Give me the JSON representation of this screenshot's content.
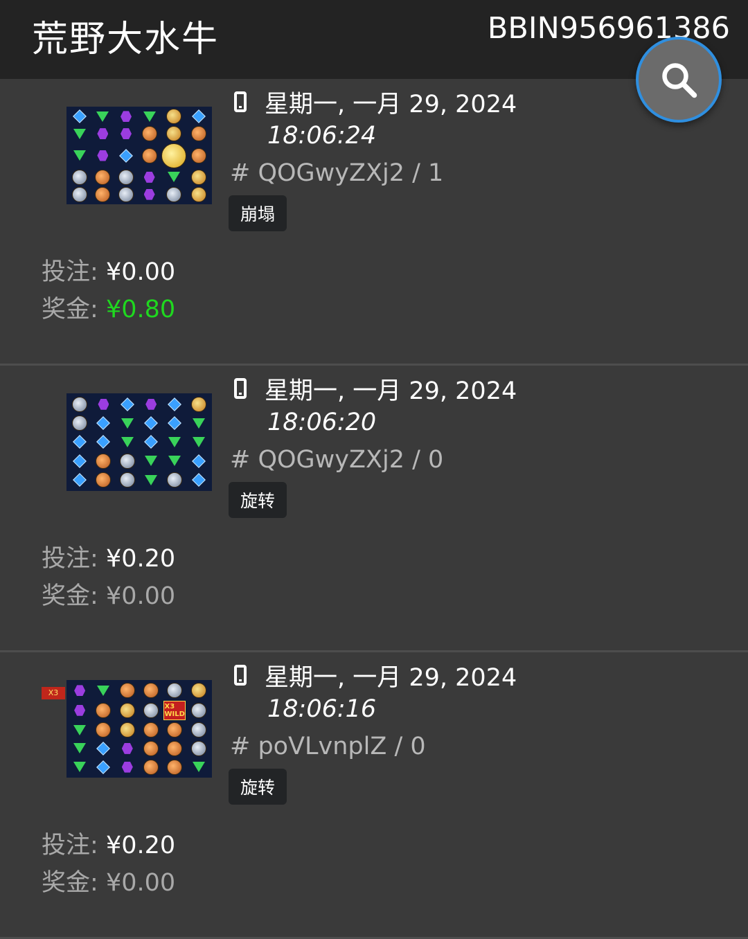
{
  "header": {
    "title": "荒野大水牛",
    "account_id": "BBIN956961386"
  },
  "search": {
    "icon": "search-icon"
  },
  "colors": {
    "win_positive": "#1fd81f",
    "header_bg": "#232323",
    "fab_border": "#2f8fe0"
  },
  "labels": {
    "bet": "投注:",
    "win": "奖金:"
  },
  "records": [
    {
      "date": "星期一, 一月 29, 2024",
      "time": "18:06:24",
      "round": "# QOGwyZXj2 / 1",
      "type": "崩塌",
      "bet": "¥0.00",
      "win": "¥0.80"
    },
    {
      "date": "星期一, 一月 29, 2024",
      "time": "18:06:20",
      "round": "# QOGwyZXj2 / 0",
      "type": "旋转",
      "bet": "¥0.20",
      "win": "¥0.00"
    },
    {
      "date": "星期一, 一月 29, 2024",
      "time": "18:06:16",
      "round": "# poVLvnplZ / 0",
      "type": "旋转",
      "bet": "¥0.20",
      "win": "¥0.00",
      "multiplier": "X3",
      "wild": "X3 WILD"
    }
  ]
}
